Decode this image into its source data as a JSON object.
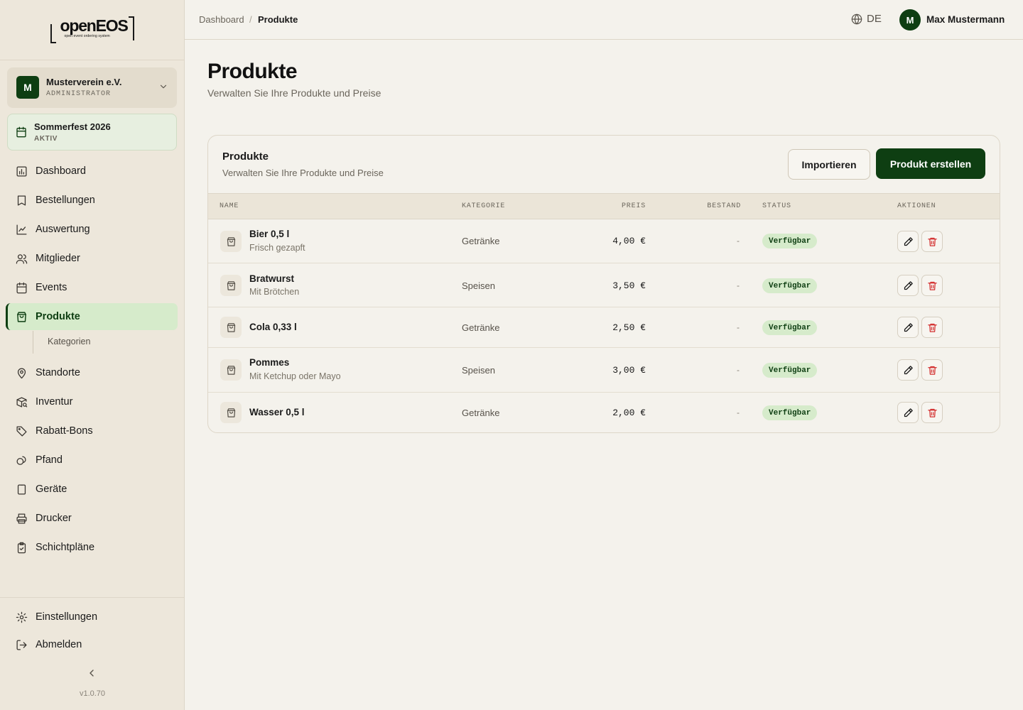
{
  "app": {
    "logo_word": "openEOS",
    "logo_tagline": "open event ordering system",
    "version": "v1.0.70"
  },
  "sidebar": {
    "org": {
      "initial": "M",
      "name": "Musterverein e.V.",
      "role": "ADMINISTRATOR"
    },
    "event": {
      "name": "Sommerfest 2026",
      "status": "AKTIV"
    },
    "items": [
      {
        "label": "Dashboard",
        "icon": "chart-bar-icon"
      },
      {
        "label": "Bestellungen",
        "icon": "receipt-icon"
      },
      {
        "label": "Auswertung",
        "icon": "line-chart-icon"
      },
      {
        "label": "Mitglieder",
        "icon": "users-icon"
      },
      {
        "label": "Events",
        "icon": "calendar-icon"
      },
      {
        "label": "Produkte",
        "icon": "shopping-bag-icon",
        "active": true
      },
      {
        "label": "Standorte",
        "icon": "map-pin-icon"
      },
      {
        "label": "Inventur",
        "icon": "package-search-icon"
      },
      {
        "label": "Rabatt-Bons",
        "icon": "tag-icon"
      },
      {
        "label": "Pfand",
        "icon": "coins-icon"
      },
      {
        "label": "Geräte",
        "icon": "device-icon"
      },
      {
        "label": "Drucker",
        "icon": "printer-icon"
      },
      {
        "label": "Schichtpläne",
        "icon": "clipboard-check-icon"
      }
    ],
    "sub_item": "Kategorien",
    "bottom": [
      {
        "label": "Einstellungen",
        "icon": "gear-icon"
      },
      {
        "label": "Abmelden",
        "icon": "logout-icon"
      }
    ]
  },
  "topbar": {
    "breadcrumb": [
      "Dashboard",
      "Produkte"
    ],
    "separator": "/",
    "language": "DE",
    "user": {
      "initial": "M",
      "name": "Max Mustermann"
    }
  },
  "page": {
    "title": "Produkte",
    "subtitle": "Verwalten Sie Ihre Produkte und Preise"
  },
  "card": {
    "title": "Produkte",
    "subtitle": "Verwalten Sie Ihre Produkte und Preise",
    "import_label": "Importieren",
    "create_label": "Produkt erstellen"
  },
  "table": {
    "headers": {
      "name": "NAME",
      "category": "KATEGORIE",
      "price": "PREIS",
      "stock": "BESTAND",
      "status": "STATUS",
      "actions": "AKTIONEN"
    },
    "rows": [
      {
        "name": "Bier 0,5 l",
        "desc": "Frisch gezapft",
        "category": "Getränke",
        "price": "4,00 €",
        "stock": "-",
        "status": "Verfügbar"
      },
      {
        "name": "Bratwurst",
        "desc": "Mit Brötchen",
        "category": "Speisen",
        "price": "3,50 €",
        "stock": "-",
        "status": "Verfügbar"
      },
      {
        "name": "Cola 0,33 l",
        "desc": "",
        "category": "Getränke",
        "price": "2,50 €",
        "stock": "-",
        "status": "Verfügbar"
      },
      {
        "name": "Pommes",
        "desc": "Mit Ketchup oder Mayo",
        "category": "Speisen",
        "price": "3,00 €",
        "stock": "-",
        "status": "Verfügbar"
      },
      {
        "name": "Wasser 0,5 l",
        "desc": "",
        "category": "Getränke",
        "price": "2,00 €",
        "stock": "-",
        "status": "Verfügbar"
      }
    ]
  },
  "colors": {
    "accent": "#0e3e12",
    "active_bg": "#d6ebcb",
    "delete": "#d32f2f"
  }
}
